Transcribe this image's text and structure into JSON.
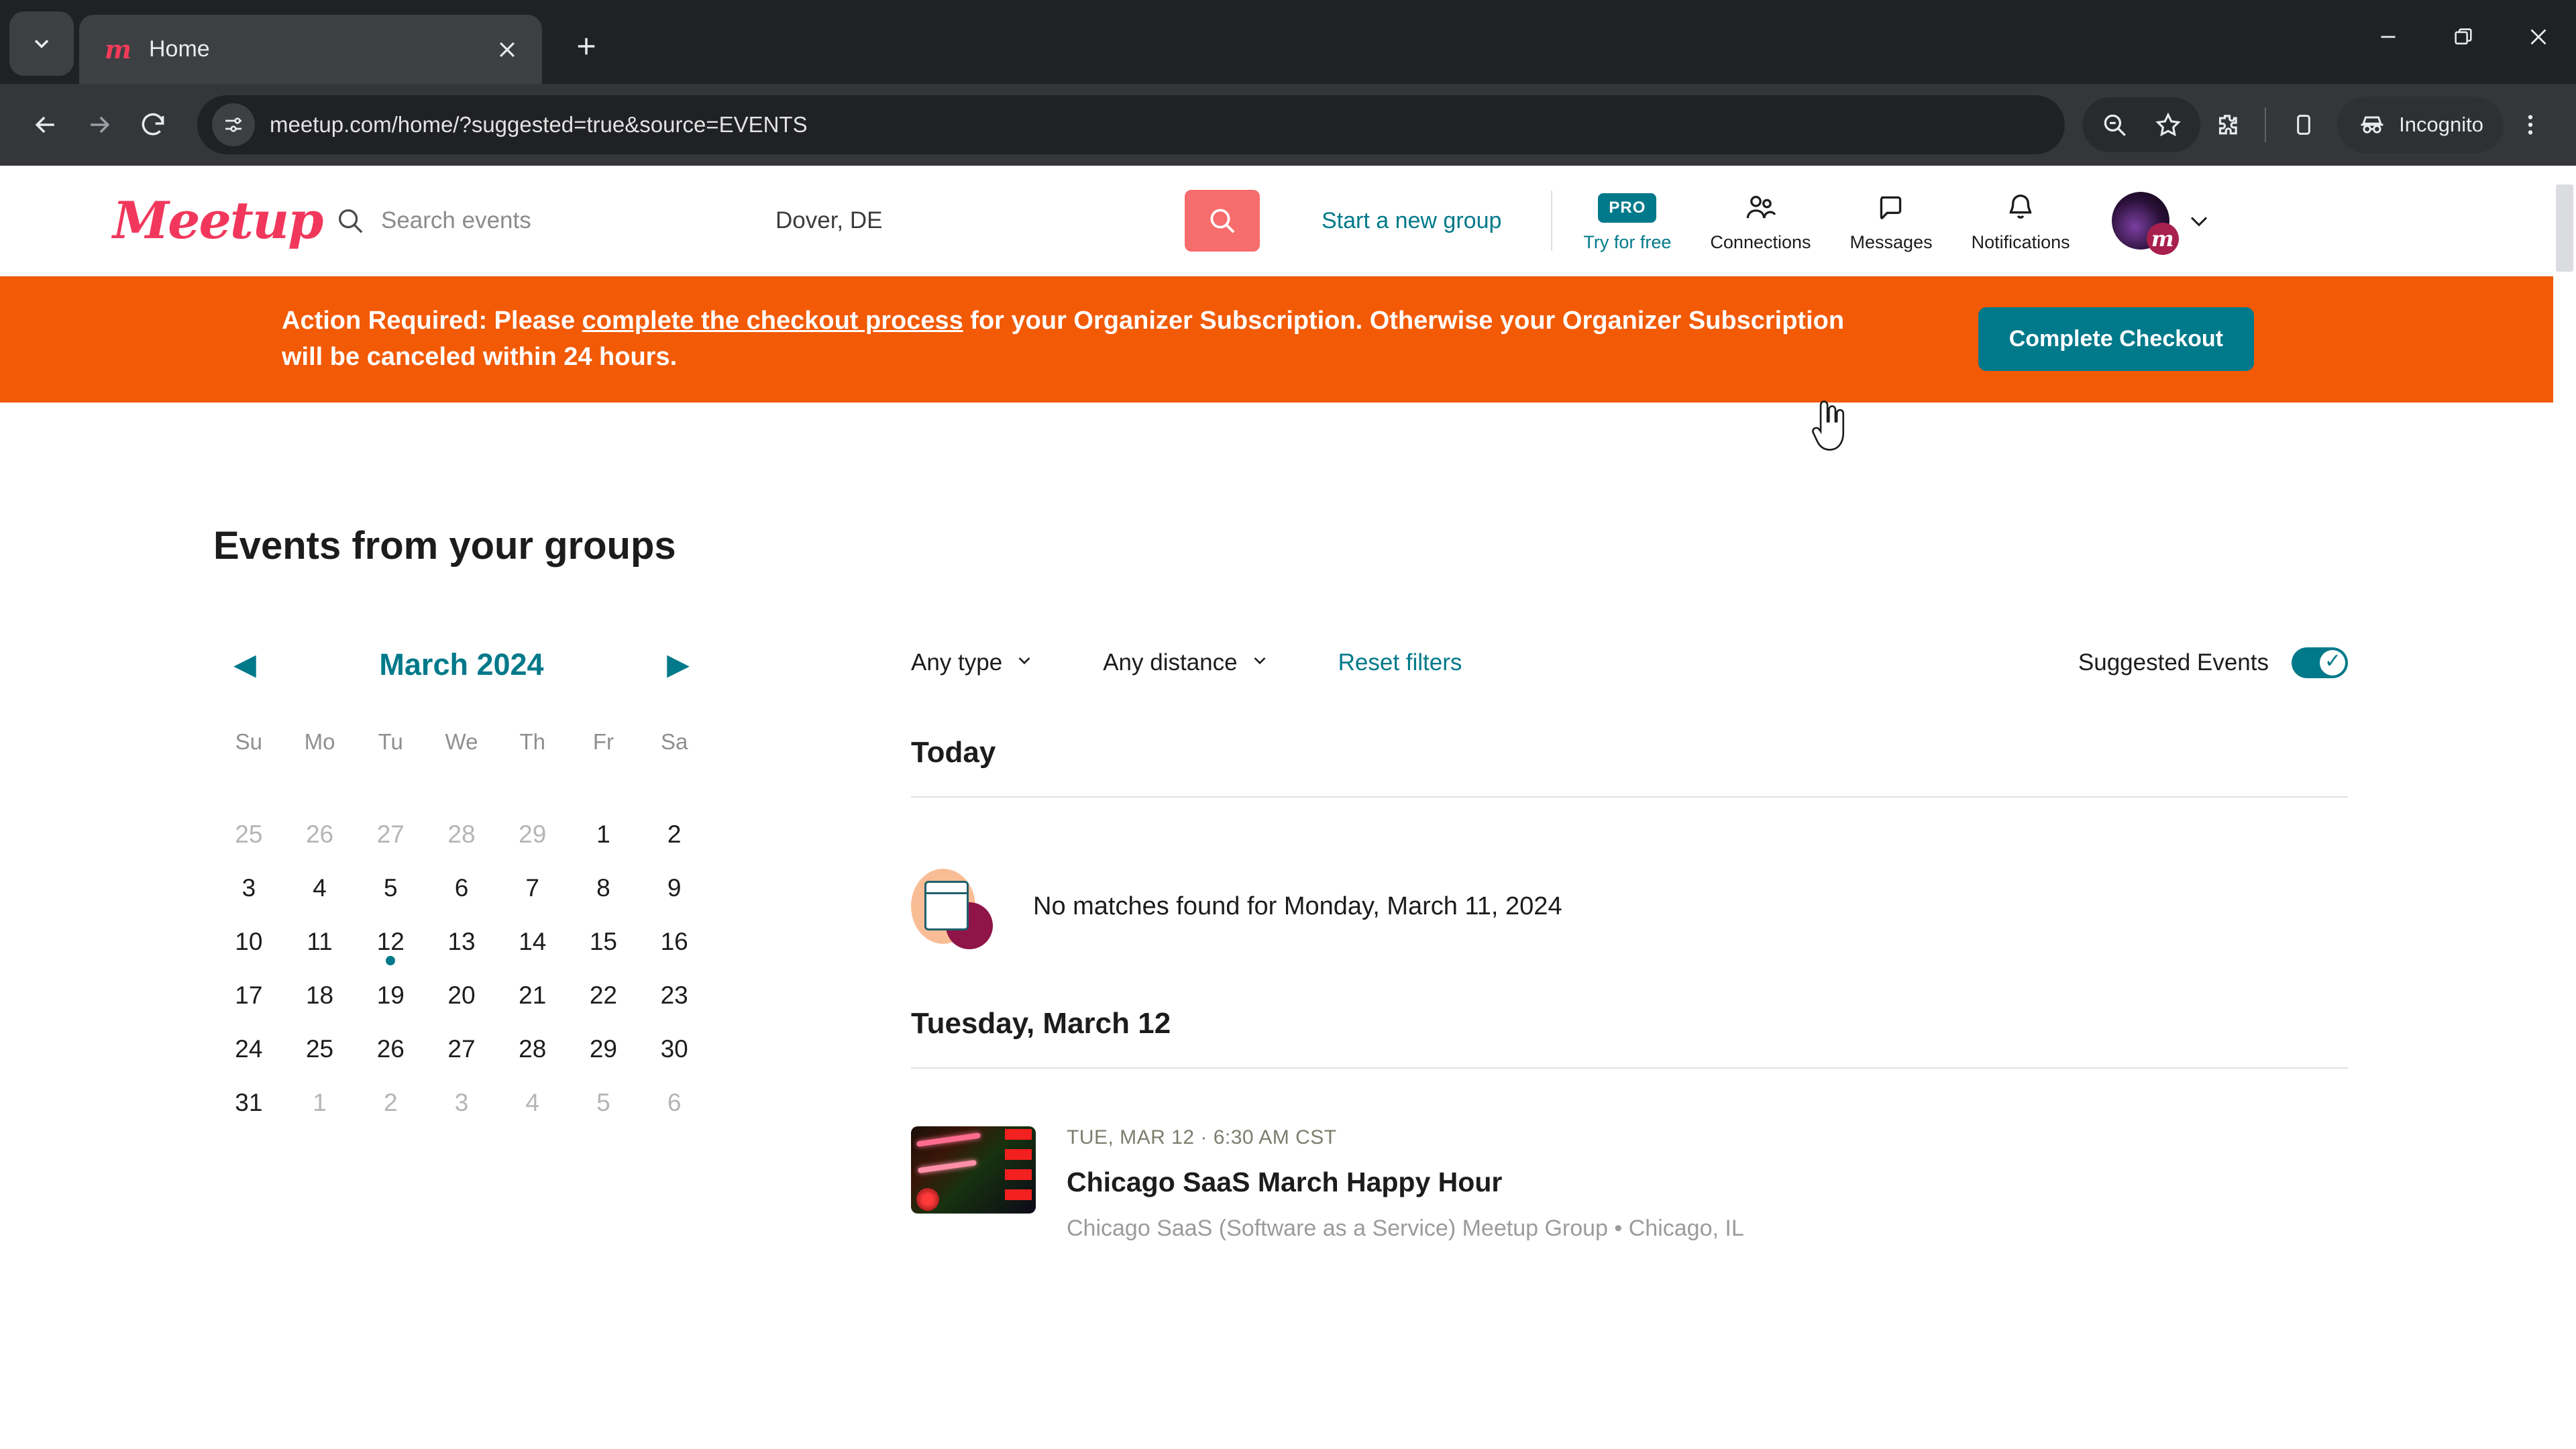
{
  "browser": {
    "tab": {
      "title": "Home",
      "favicon_icon": "meetup-favicon",
      "close_icon": "close-icon"
    },
    "tab_list_icon": "chevron-down-icon",
    "new_tab_icon": "plus-icon",
    "window": {
      "minimize_icon": "minimize-icon",
      "maximize_icon": "maximize-icon",
      "close_icon": "window-close-icon"
    },
    "nav": {
      "back_icon": "back-arrow-icon",
      "forward_icon": "forward-arrow-icon",
      "reload_icon": "reload-icon"
    },
    "omnibox": {
      "url": "meetup.com/home/?suggested=true&source=EVENTS",
      "site_info_icon": "site-settings-icon"
    },
    "toolbar_right": {
      "zoom_out_icon": "zoom-out-icon",
      "bookmark_icon": "star-icon",
      "extensions_icon": "extensions-icon",
      "side_panel_icon": "side-panel-icon",
      "incognito_label": "Incognito",
      "incognito_icon": "incognito-icon",
      "menu_icon": "kebab-menu-icon"
    }
  },
  "site_header": {
    "logo_text": "Meetup",
    "search": {
      "placeholder": "Search events",
      "icon": "search-icon"
    },
    "location": {
      "value": "Dover, DE"
    },
    "search_button_icon": "search-submit-icon",
    "start_group_label": "Start a new group",
    "nav": [
      {
        "label": "Try for free",
        "badge": "PRO",
        "icon": "pro-badge-icon"
      },
      {
        "label": "Connections",
        "icon": "people-icon"
      },
      {
        "label": "Messages",
        "icon": "chat-bubble-icon"
      },
      {
        "label": "Notifications",
        "icon": "bell-icon"
      }
    ],
    "avatar_icon": "user-avatar",
    "avatar_chevron_icon": "chevron-down-icon"
  },
  "alert_banner": {
    "prefix": "Action Required: Please ",
    "link_text": "complete the checkout process",
    "suffix": " for your Organizer Subscription. Otherwise your Organizer Subscription will be canceled within 24 hours.",
    "button_label": "Complete Checkout",
    "bg_color": "#f25a05",
    "button_color": "#00798a"
  },
  "main": {
    "page_title": "Events from your groups",
    "calendar": {
      "month_label": "March 2024",
      "prev_icon": "prev-month-icon",
      "next_icon": "next-month-icon",
      "dow": [
        "Su",
        "Mo",
        "Tu",
        "We",
        "Th",
        "Fr",
        "Sa"
      ],
      "weeks": [
        [
          {
            "d": "25",
            "muted": true
          },
          {
            "d": "26",
            "muted": true
          },
          {
            "d": "27",
            "muted": true
          },
          {
            "d": "28",
            "muted": true
          },
          {
            "d": "29",
            "muted": true
          },
          {
            "d": "1"
          },
          {
            "d": "2"
          }
        ],
        [
          {
            "d": "3"
          },
          {
            "d": "4"
          },
          {
            "d": "5"
          },
          {
            "d": "6"
          },
          {
            "d": "7"
          },
          {
            "d": "8"
          },
          {
            "d": "9"
          }
        ],
        [
          {
            "d": "10"
          },
          {
            "d": "11"
          },
          {
            "d": "12",
            "dot": true
          },
          {
            "d": "13"
          },
          {
            "d": "14"
          },
          {
            "d": "15"
          },
          {
            "d": "16"
          }
        ],
        [
          {
            "d": "17"
          },
          {
            "d": "18"
          },
          {
            "d": "19"
          },
          {
            "d": "20"
          },
          {
            "d": "21"
          },
          {
            "d": "22"
          },
          {
            "d": "23"
          }
        ],
        [
          {
            "d": "24"
          },
          {
            "d": "25"
          },
          {
            "d": "26"
          },
          {
            "d": "27"
          },
          {
            "d": "28"
          },
          {
            "d": "29"
          },
          {
            "d": "30"
          }
        ],
        [
          {
            "d": "31"
          },
          {
            "d": "1",
            "muted": true
          },
          {
            "d": "2",
            "muted": true
          },
          {
            "d": "3",
            "muted": true
          },
          {
            "d": "4",
            "muted": true
          },
          {
            "d": "5",
            "muted": true
          },
          {
            "d": "6",
            "muted": true
          }
        ]
      ],
      "accent_color": "#00798a"
    },
    "filters": {
      "type_label": "Any type",
      "distance_label": "Any distance",
      "reset_label": "Reset filters",
      "suggested_label": "Suggested Events",
      "suggested_on": true
    },
    "sections": [
      {
        "title": "Today",
        "empty_text": "No matches found for Monday, March 11, 2024"
      },
      {
        "title": "Tuesday, March 12",
        "event": {
          "meta": "TUE, MAR 12 · 6:30 AM CST",
          "title": "Chicago SaaS March Happy Hour",
          "group": "Chicago SaaS (Software as a Service) Meetup Group • Chicago, IL",
          "thumb_icon": "event-thumbnail"
        }
      }
    ]
  }
}
